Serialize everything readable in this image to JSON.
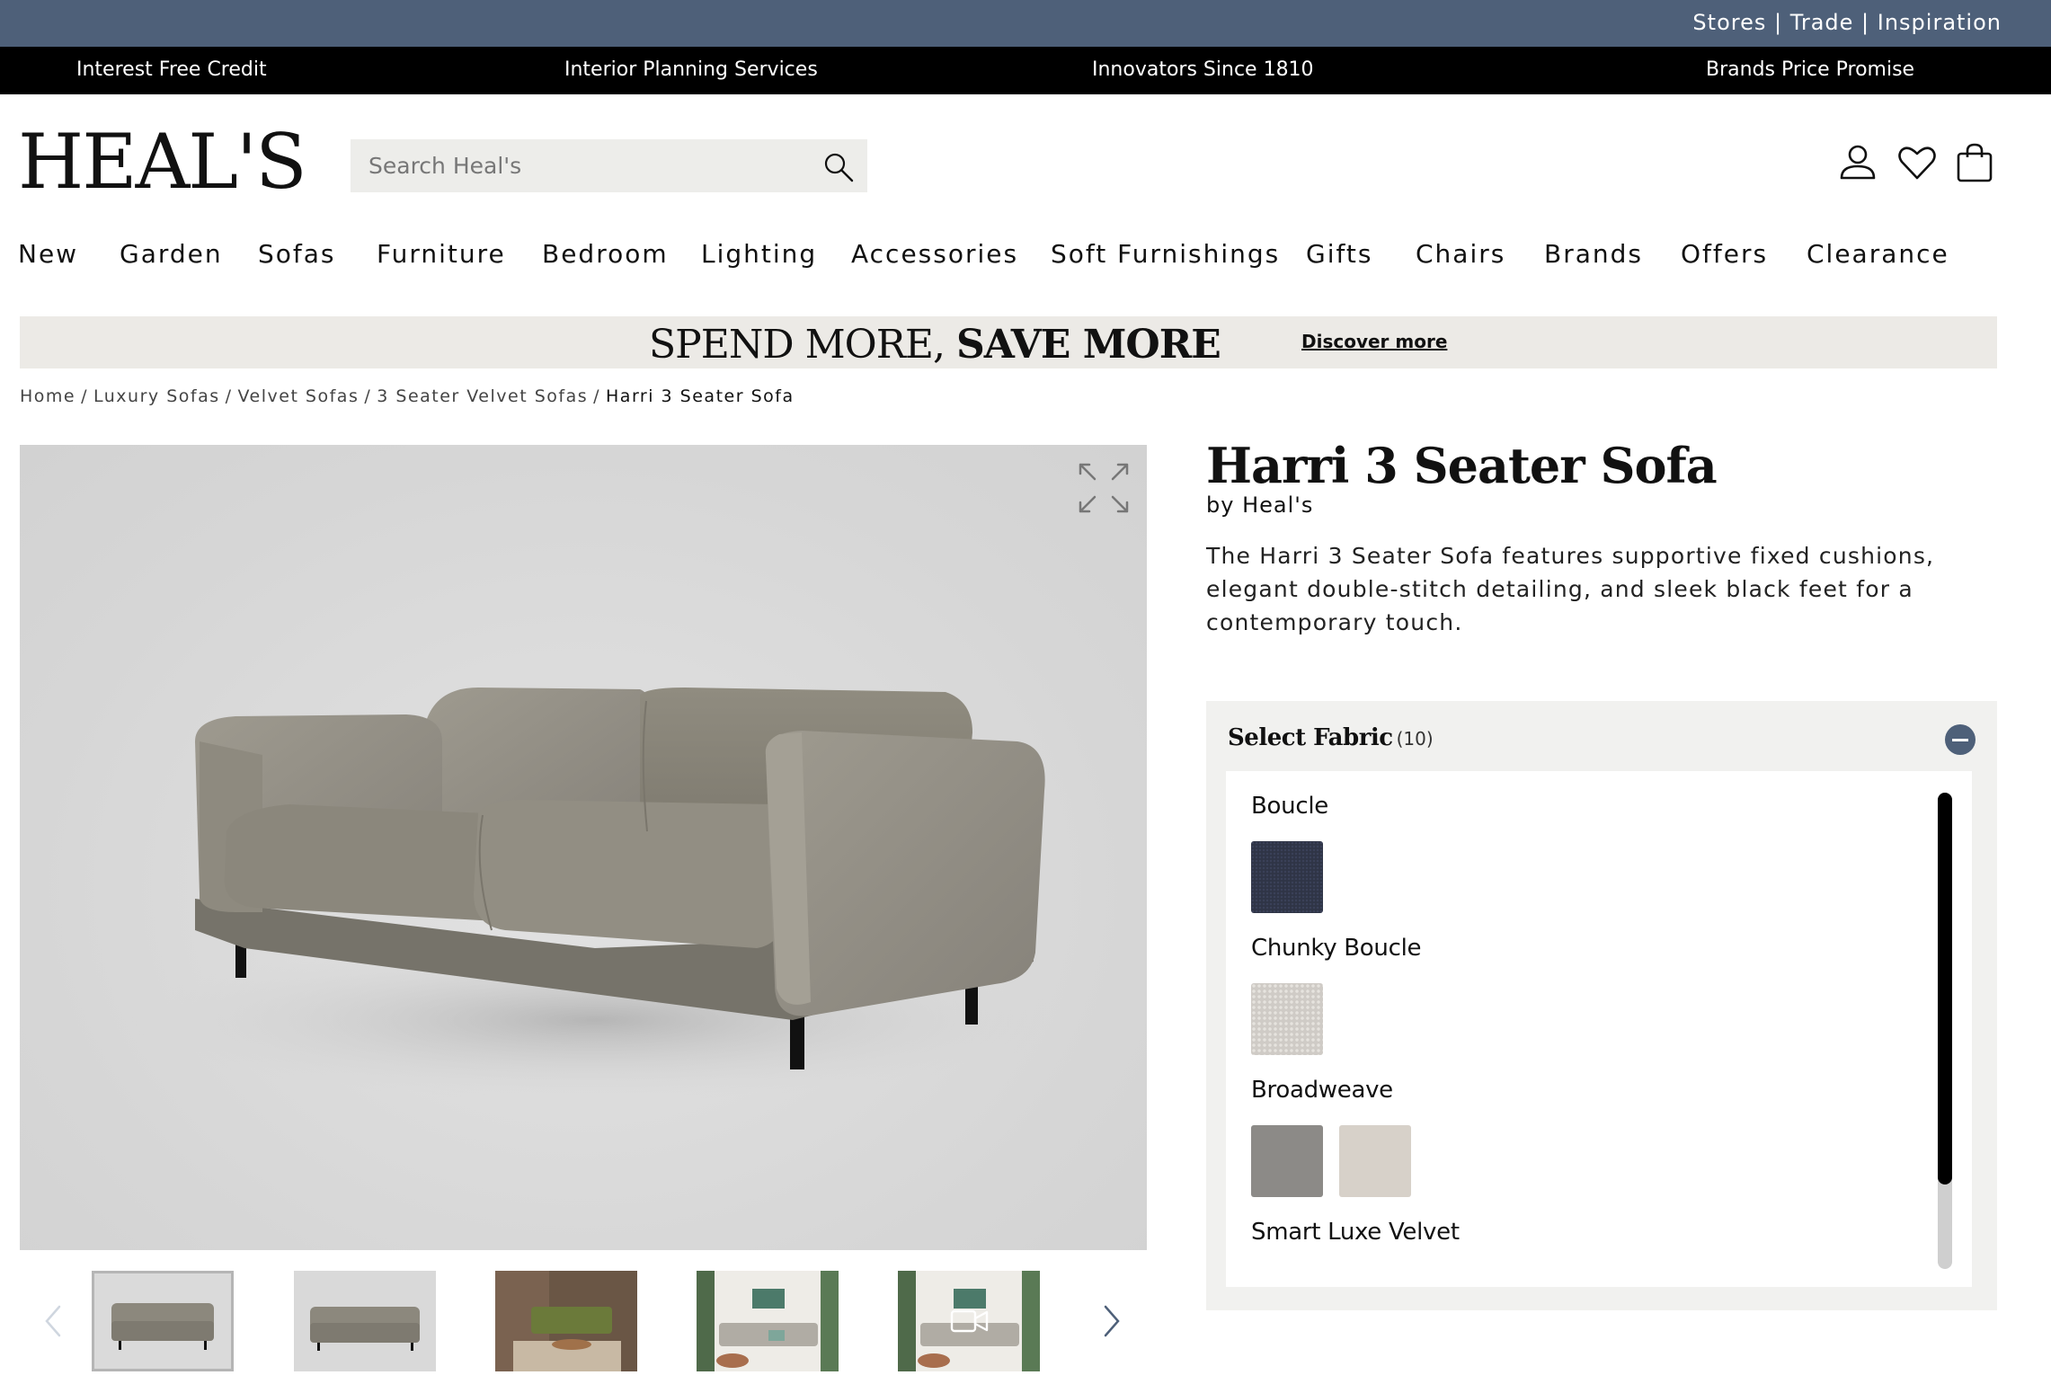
{
  "utility_bar": {
    "links": "Stores | Trade | Inspiration"
  },
  "usp_bar": {
    "items": [
      "Interest Free Credit",
      "Interior Planning Services",
      "Innovators Since 1810",
      "Brands Price Promise"
    ]
  },
  "header": {
    "logo": "HEAL'S",
    "search_placeholder": "Search Heal's",
    "icons": [
      "account-icon",
      "wishlist-heart-icon",
      "shopping-bag-icon"
    ]
  },
  "nav": {
    "items": [
      "New",
      "Garden",
      "Sofas",
      "Furniture",
      "Bedroom",
      "Lighting",
      "Accessories",
      "Soft Furnishings",
      "Gifts",
      "Chairs",
      "Brands",
      "Offers",
      "Clearance"
    ]
  },
  "promo": {
    "text_light": "SPEND MORE, ",
    "text_bold": "SAVE MORE",
    "link": "Discover more"
  },
  "breadcrumb": {
    "items": [
      "Home",
      "Luxury Sofas",
      "Velvet Sofas",
      "3 Seater Velvet Sofas"
    ],
    "current": "Harri 3 Seater Sofa",
    "separator": "/"
  },
  "product": {
    "title": "Harri 3 Seater Sofa",
    "brand": "by Heal's",
    "description": "The Harri 3 Seater Sofa features supportive fixed cushions, elegant double-stitch detailing, and sleek black feet for a contemporary touch."
  },
  "gallery": {
    "thumbnails": [
      "sofa-studio-front",
      "sofa-studio-angle",
      "living-room-scene",
      "open-plan-room-scene",
      "room-video"
    ],
    "active_index": 0
  },
  "fabric": {
    "title": "Select Fabric",
    "count": "(10)",
    "groups": [
      {
        "label": "Boucle",
        "swatches": [
          "#2f3446"
        ]
      },
      {
        "label": "Chunky Boucle",
        "swatches": [
          "#cfcbc6"
        ]
      },
      {
        "label": "Broadweave",
        "swatches": [
          "#8c8a87",
          "#d7d1c9"
        ]
      },
      {
        "label": "Smart Luxe Velvet",
        "swatches": []
      }
    ]
  },
  "colors": {
    "utility_bar": "#4e6079",
    "usp_bar": "#000000",
    "accent": "#4e6079",
    "promo_bg": "#eceae6"
  }
}
